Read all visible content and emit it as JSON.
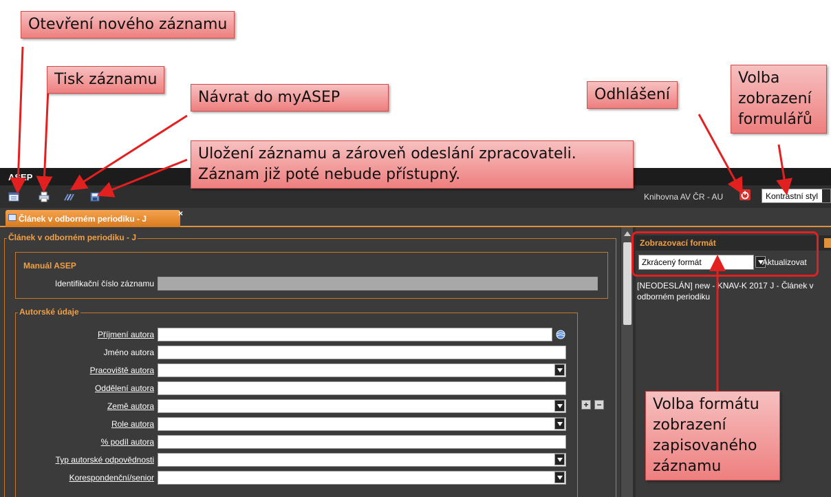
{
  "app": {
    "title": "ASEP",
    "library_name": "Knihovna AV ČR - AU",
    "style_select_value": "Kontrastní styl"
  },
  "toolbar": {
    "buttons": [
      {
        "name": "new-record-icon"
      },
      {
        "name": "print-icon"
      },
      {
        "name": "myasep-return-icon"
      },
      {
        "name": "save-send-icon"
      }
    ]
  },
  "tab": {
    "label": "Článek v odborném periodiku - J",
    "close": "×"
  },
  "form": {
    "outer_legend": "Článek v odborném periodiku - J",
    "manual_legend": "Manuál ASEP",
    "id_label": "Identifikační číslo záznamu",
    "author_legend": "Autorské údaje",
    "fields": [
      {
        "label": "Příjmení autora",
        "link": true
      },
      {
        "label": "Jméno autora",
        "link": false
      },
      {
        "label": "Pracoviště autora",
        "link": true
      },
      {
        "label": "Oddělení autora",
        "link": true
      },
      {
        "label": "Země autora",
        "link": true
      },
      {
        "label": "Role autora",
        "link": true
      },
      {
        "label": "% podíl autora",
        "link": true
      },
      {
        "label": "Typ autorské odpovědnosti",
        "link": true
      },
      {
        "label": "Korespondenční/senior",
        "link": true
      }
    ],
    "plus": "+",
    "minus": "−"
  },
  "right_panel": {
    "header": "Zobrazovací formát",
    "format_value": "Zkrácený formát",
    "refresh_label": "Aktualizovat",
    "preview": "[NEODESLÁN] new - KNAV-K 2017 J - Článek v odborném periodiku"
  },
  "annotations": {
    "new_record": "Otevření nového záznamu",
    "print": "Tisk záznamu",
    "myasep": "Návrat do myASEP",
    "save": "Uložení záznamu a zároveň odeslání zpracovateli. Záznam již poté nebude přístupný.",
    "logout": "Odhlášení",
    "form_style": "Volba zobrazení formulářů",
    "format": "Volba formátu zobrazení zapisovaného záznamu"
  },
  "colors": {
    "accent": "#e0913a",
    "callout": "#ee7f7f",
    "arrow": "#e32020"
  }
}
